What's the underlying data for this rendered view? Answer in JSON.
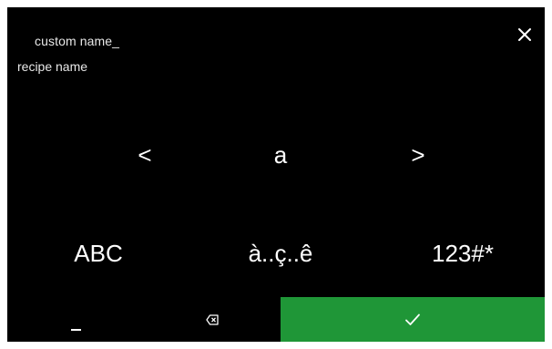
{
  "header": {
    "title": "custom name_",
    "subtitle": "recipe name",
    "close_icon": "close-icon"
  },
  "selector": {
    "prev_label": "<",
    "current_char": "a",
    "next_label": ">"
  },
  "modes": {
    "uppercase_label": "ABC",
    "accents_label": "à..ç..ê",
    "symbols_label": "123#*"
  },
  "bottom_bar": {
    "space_icon": "space-icon",
    "backspace_icon": "backspace-icon",
    "confirm_icon": "checkmark-icon"
  },
  "colors": {
    "background": "#000000",
    "confirm": "#1f9637",
    "text": "#ffffff"
  }
}
